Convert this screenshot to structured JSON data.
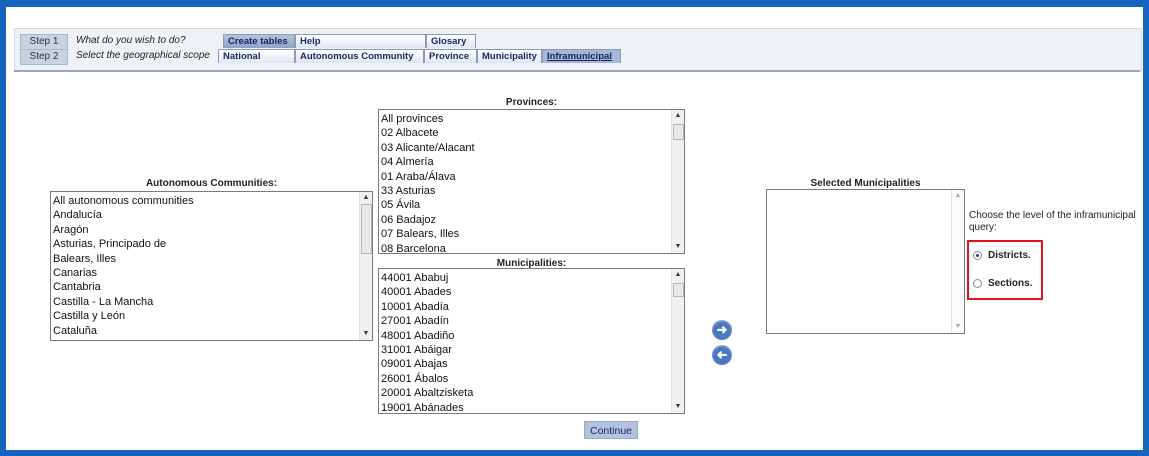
{
  "steps": [
    {
      "label": "Step 1",
      "question": "What do you wish to do?"
    },
    {
      "label": "Step 2",
      "question": "Select the geographical scope"
    }
  ],
  "tabs_row1": [
    "Create tables",
    "Help",
    "Glosary"
  ],
  "tabs_row2": [
    "National",
    "Autonomous Community",
    "Province",
    "Municipality",
    "Inframunicipal"
  ],
  "autonomous": {
    "label": "Autonomous Communities:",
    "items": [
      "All autonomous communities",
      "Andalucía",
      "Aragón",
      "Asturias, Principado de",
      "Balears, Illes",
      "Canarias",
      "Cantabria",
      "Castilla - La Mancha",
      "Castilla y León",
      "Cataluña"
    ]
  },
  "provinces": {
    "label": "Provinces:",
    "items": [
      "All provinces",
      "02 Albacete",
      "03 Alicante/Alacant",
      "04 Almería",
      "01 Araba/Álava",
      "33 Asturias",
      "05 Ávila",
      "06 Badajoz",
      "07 Balears, Illes",
      "08 Barcelona"
    ]
  },
  "municipalities": {
    "label": "Municipalities:",
    "items": [
      "44001 Ababuj",
      "40001 Abades",
      "10001 Abadía",
      "27001 Abadín",
      "48001 Abadiño",
      "31001 Abáigar",
      "09001 Abajas",
      "26001 Ábalos",
      "20001 Abaltzisketa",
      "19001 Abánades"
    ]
  },
  "selected": {
    "label": "Selected Municipalities"
  },
  "arrows": {
    "add": "add-arrow-icon",
    "remove": "remove-arrow-icon"
  },
  "continue_label": "Continue",
  "level": {
    "prompt": "Choose the level of the inframunicipal query:",
    "options": [
      "Districts.",
      "Sections."
    ],
    "selected": "Districts."
  },
  "colors": {
    "frame": "#1565c0",
    "highlight": "#e0141e",
    "tab_active": "#a5b7d8"
  }
}
